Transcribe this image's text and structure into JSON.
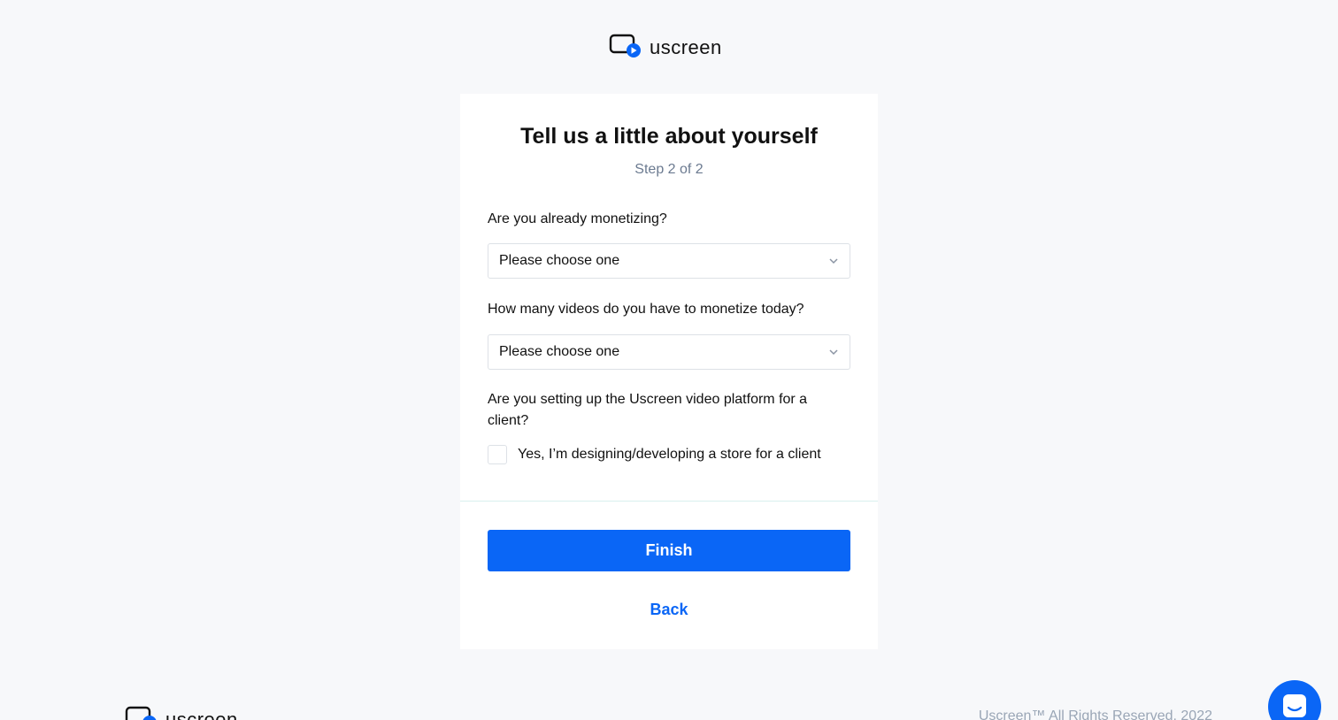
{
  "header": {
    "logo_text": "uscreen",
    "logo_icon": "uscreen-play-icon"
  },
  "form": {
    "title": "Tell us a little about yourself",
    "step": "Step 2 of 2",
    "question_monetizing": "Are you already monetizing?",
    "select_monetizing_value": "Please choose one",
    "question_videos": "How many videos do you have to monetize today?",
    "select_videos_value": "Please choose one",
    "question_client": "Are you setting up the Uscreen video platform for a client?",
    "checkbox_client_label": "Yes, I’m designing/developing a store for a client",
    "checkbox_client_checked": false,
    "finish_label": "Finish",
    "back_label": "Back"
  },
  "footer": {
    "logo_text": "uscreen",
    "copyright": "Uscreen™ All Rights Reserved, 2022"
  },
  "colors": {
    "accent": "#0a66f6",
    "background": "#f7f8fa",
    "subtitle": "#6b7a90"
  }
}
